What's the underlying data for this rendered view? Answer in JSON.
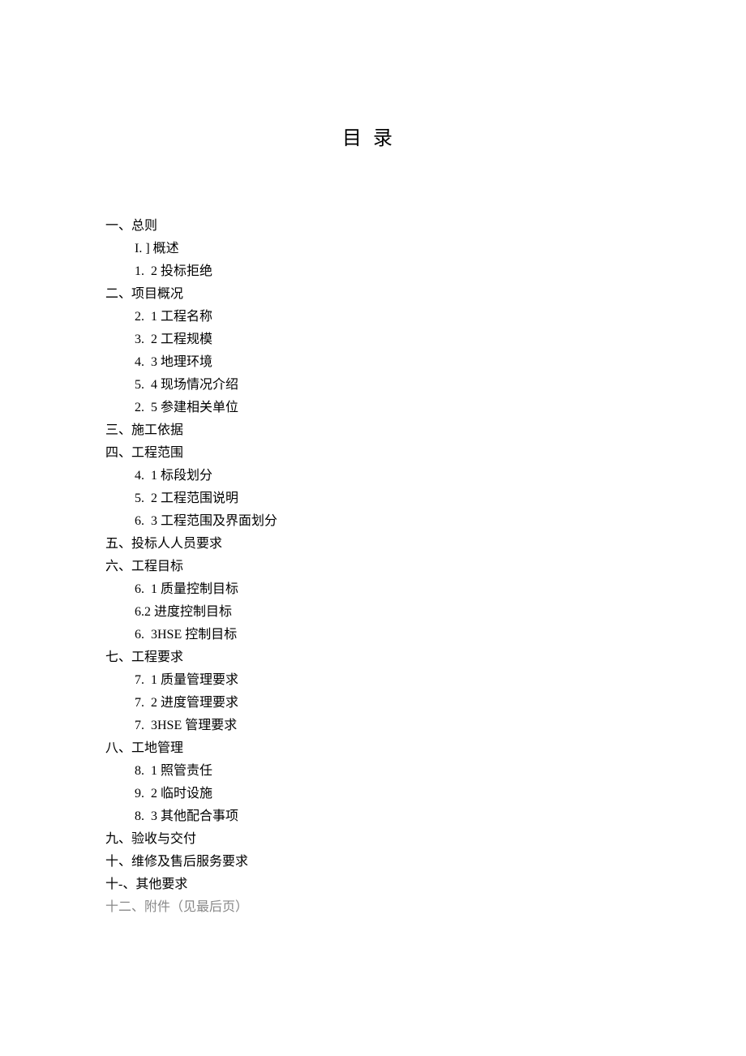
{
  "title": "目录",
  "toc": [
    {
      "level": 1,
      "num": "一、",
      "text": "总则"
    },
    {
      "level": 2,
      "num": "I. ] ",
      "text": "概述"
    },
    {
      "level": 2,
      "num": "1.  2 ",
      "text": "投标拒绝"
    },
    {
      "level": 1,
      "num": "二、",
      "text": "项目概况"
    },
    {
      "level": 2,
      "num": "2.  1 ",
      "text": "工程名称"
    },
    {
      "level": 2,
      "num": "3.  2 ",
      "text": "工程规模"
    },
    {
      "level": 2,
      "num": "4.  3 ",
      "text": "地理环境"
    },
    {
      "level": 2,
      "num": "5.  4 ",
      "text": "现场情况介绍"
    },
    {
      "level": 2,
      "num": "2.  5 ",
      "text": "参建相关单位"
    },
    {
      "level": 1,
      "num": "三、",
      "text": "施工依据"
    },
    {
      "level": 1,
      "num": "四、",
      "text": "工程范围"
    },
    {
      "level": 2,
      "num": "4.  1 ",
      "text": "标段划分"
    },
    {
      "level": 2,
      "num": "5.  2 ",
      "text": "工程范围说明"
    },
    {
      "level": 2,
      "num": "6.  3 ",
      "text": "工程范围及界面划分"
    },
    {
      "level": 1,
      "num": "五、",
      "text": "投标人人员要求"
    },
    {
      "level": 1,
      "num": "六、",
      "text": "工程目标"
    },
    {
      "level": 2,
      "num": "6.  1 ",
      "text": "质量控制目标"
    },
    {
      "level": 2,
      "num": "6.2 ",
      "text": "进度控制目标"
    },
    {
      "level": 2,
      "num": "6.  3",
      "text": "HSE 控制目标"
    },
    {
      "level": 1,
      "num": "七、",
      "text": "工程要求"
    },
    {
      "level": 2,
      "num": "7.  1 ",
      "text": "质量管理要求"
    },
    {
      "level": 2,
      "num": "7.  2 ",
      "text": "进度管理要求"
    },
    {
      "level": 2,
      "num": "7.  3",
      "text": "HSE 管理要求"
    },
    {
      "level": 1,
      "num": "八、",
      "text": "工地管理"
    },
    {
      "level": 2,
      "num": "8.  1 ",
      "text": "照管责任"
    },
    {
      "level": 2,
      "num": "9.  2 ",
      "text": "临时设施"
    },
    {
      "level": 2,
      "num": "8.  3 ",
      "text": "其他配合事项"
    },
    {
      "level": 1,
      "num": "九、",
      "text": "验收与交付"
    },
    {
      "level": 1,
      "num": "十、",
      "text": "维修及售后服务要求"
    },
    {
      "level": 1,
      "num": "十-、",
      "text": "其他要求"
    },
    {
      "level": 1,
      "num": "十二、",
      "text": "附件（见最后页）",
      "grey": true
    }
  ]
}
